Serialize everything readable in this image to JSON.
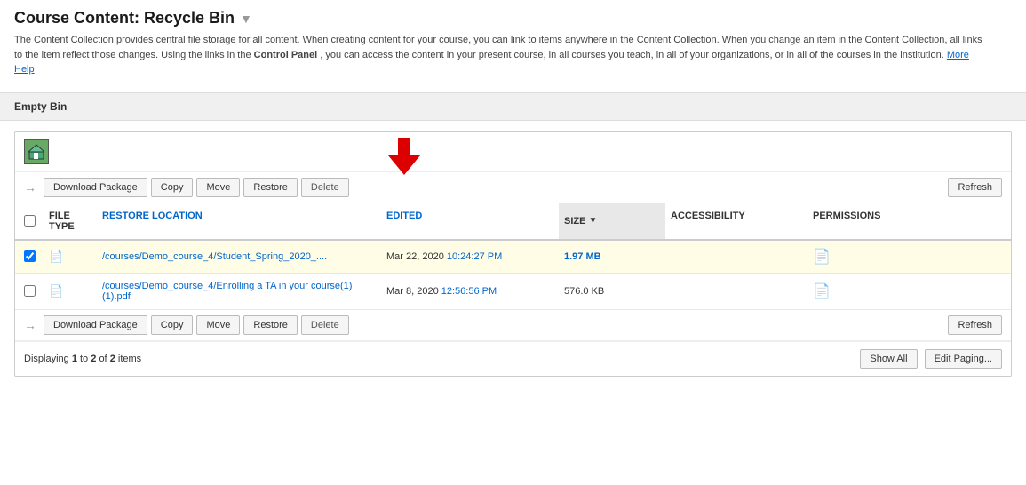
{
  "page": {
    "title": "Course Content: Recycle Bin",
    "description": "The Content Collection provides central file storage for all content. When creating content for your course, you can link to items anywhere in the Content Collection. When you change an item in the Content Collection, all links to the item reflect those changes. Using the links in the",
    "description_bold": "Control Panel",
    "description_cont": ", you can access the content in your present course, in all courses you teach, in all of your organizations, or in all of the courses in the institution.",
    "more_help": "More Help",
    "empty_bin_label": "Empty Bin"
  },
  "toolbar": {
    "download_label": "Download Package",
    "copy_label": "Copy",
    "move_label": "Move",
    "restore_label": "Restore",
    "delete_label": "Delete",
    "refresh_label": "Refresh"
  },
  "table": {
    "columns": {
      "file_type": "FILE TYPE",
      "restore_location": "RESTORE LOCATION",
      "edited": "EDITED",
      "size": "SIZE",
      "accessibility": "ACCESSIBILITY",
      "permissions": "PERMISSIONS"
    },
    "rows": [
      {
        "id": 1,
        "checked": true,
        "file_type": "doc",
        "restore_location": "/courses/Demo_course_4/Student_Spring_2020_....",
        "restore_location_full": "/courses/Demo_course_4/Student_Spring_2020_\"",
        "date": "Mar 22, 2020",
        "time": "10:24:27 PM",
        "size": "1.97 MB",
        "accessibility": "",
        "permissions": "file",
        "selected": true
      },
      {
        "id": 2,
        "checked": false,
        "file_type": "pdf",
        "restore_location": "/courses/Demo_course_4/Enrolling a TA in your course(1)(1).pdf",
        "date": "Mar 8, 2020",
        "time": "12:56:56 PM",
        "size": "576.0 KB",
        "accessibility": "",
        "permissions": "file",
        "selected": false
      }
    ]
  },
  "footer": {
    "displaying": "Displaying",
    "range_start": "1",
    "range_to": "to",
    "range_end": "2",
    "of": "of",
    "total": "2",
    "items": "items",
    "show_all": "Show All",
    "edit_paging": "Edit Paging..."
  }
}
